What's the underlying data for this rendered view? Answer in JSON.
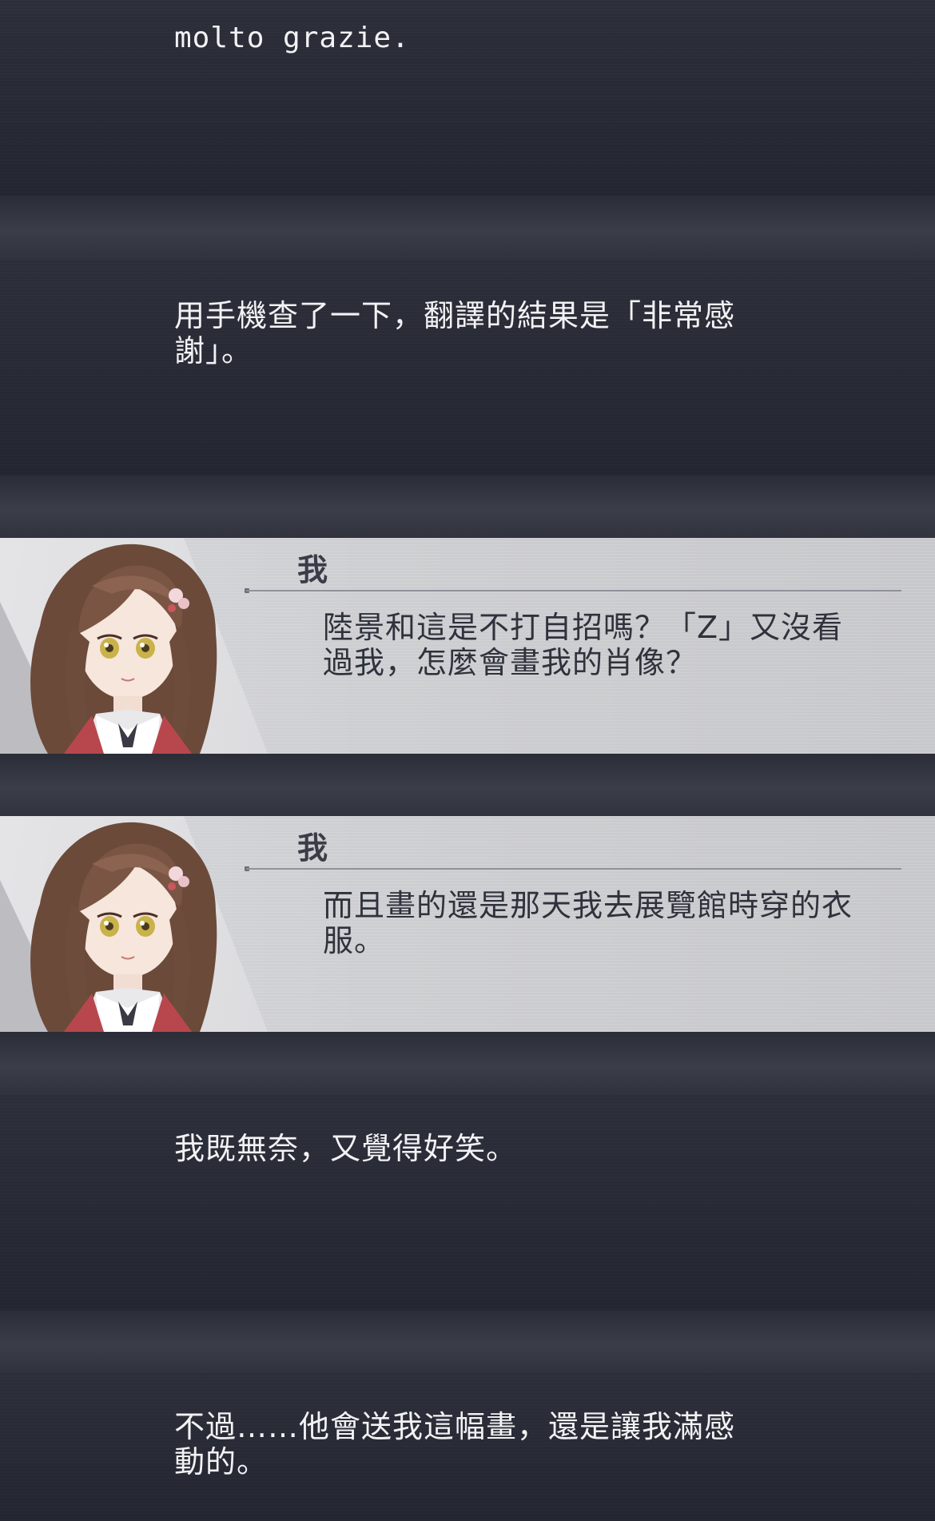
{
  "story": {
    "narration_1": "molto grazie.",
    "narration_2_line1": "用手機查了一下，翻譯的結果是「非常感",
    "narration_2_line2": "謝」。",
    "dialog_1": {
      "speaker": "我",
      "line1": "陸景和這是不打自招嗎？「Z」又沒看",
      "line2": "過我，怎麼會畫我的肖像？"
    },
    "dialog_2": {
      "speaker": "我",
      "line1": "而且畫的還是那天我去展覽館時穿的衣",
      "line2": "服。"
    },
    "narration_3": "我既無奈，又覺得好笑。",
    "narration_4_line1": "不過……他會送我這幅畫，還是讓我滿感",
    "narration_4_line2": "動的。"
  },
  "colors": {
    "background": "#2c2f39",
    "narration_text": "#f2f2f4",
    "dialog_panel": "#c9cacd",
    "dialog_text": "#2f323c"
  },
  "icons": {
    "portrait": "girl-portrait-icon"
  }
}
